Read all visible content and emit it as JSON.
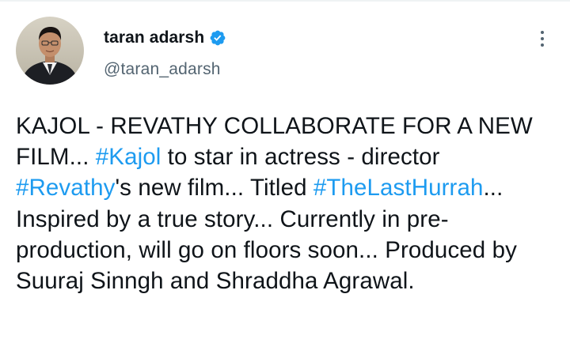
{
  "author": {
    "display_name": "taran adarsh",
    "handle": "@taran_adarsh",
    "verified": true,
    "verified_icon": "verified-badge-icon"
  },
  "menu": {
    "icon": "more-vertical-icon"
  },
  "tweet": {
    "segments": [
      {
        "type": "text",
        "value": "KAJOL - REVATHY COLLABORATE FOR A NEW FILM... "
      },
      {
        "type": "hashtag",
        "value": "#Kajol"
      },
      {
        "type": "text",
        "value": " to star in actress - director "
      },
      {
        "type": "hashtag",
        "value": "#Revathy"
      },
      {
        "type": "text",
        "value": "'s new film... Titled "
      },
      {
        "type": "hashtag",
        "value": "#TheLastHurrah"
      },
      {
        "type": "text",
        "value": "... Inspired by a true story... Currently in pre-production, will go on floors soon... Produced by Suuraj Sinngh and Shraddha Agrawal."
      }
    ]
  },
  "colors": {
    "link": "#1d9bf0",
    "text": "#0f1419",
    "secondary": "#536471",
    "verified": "#1d9bf0"
  }
}
